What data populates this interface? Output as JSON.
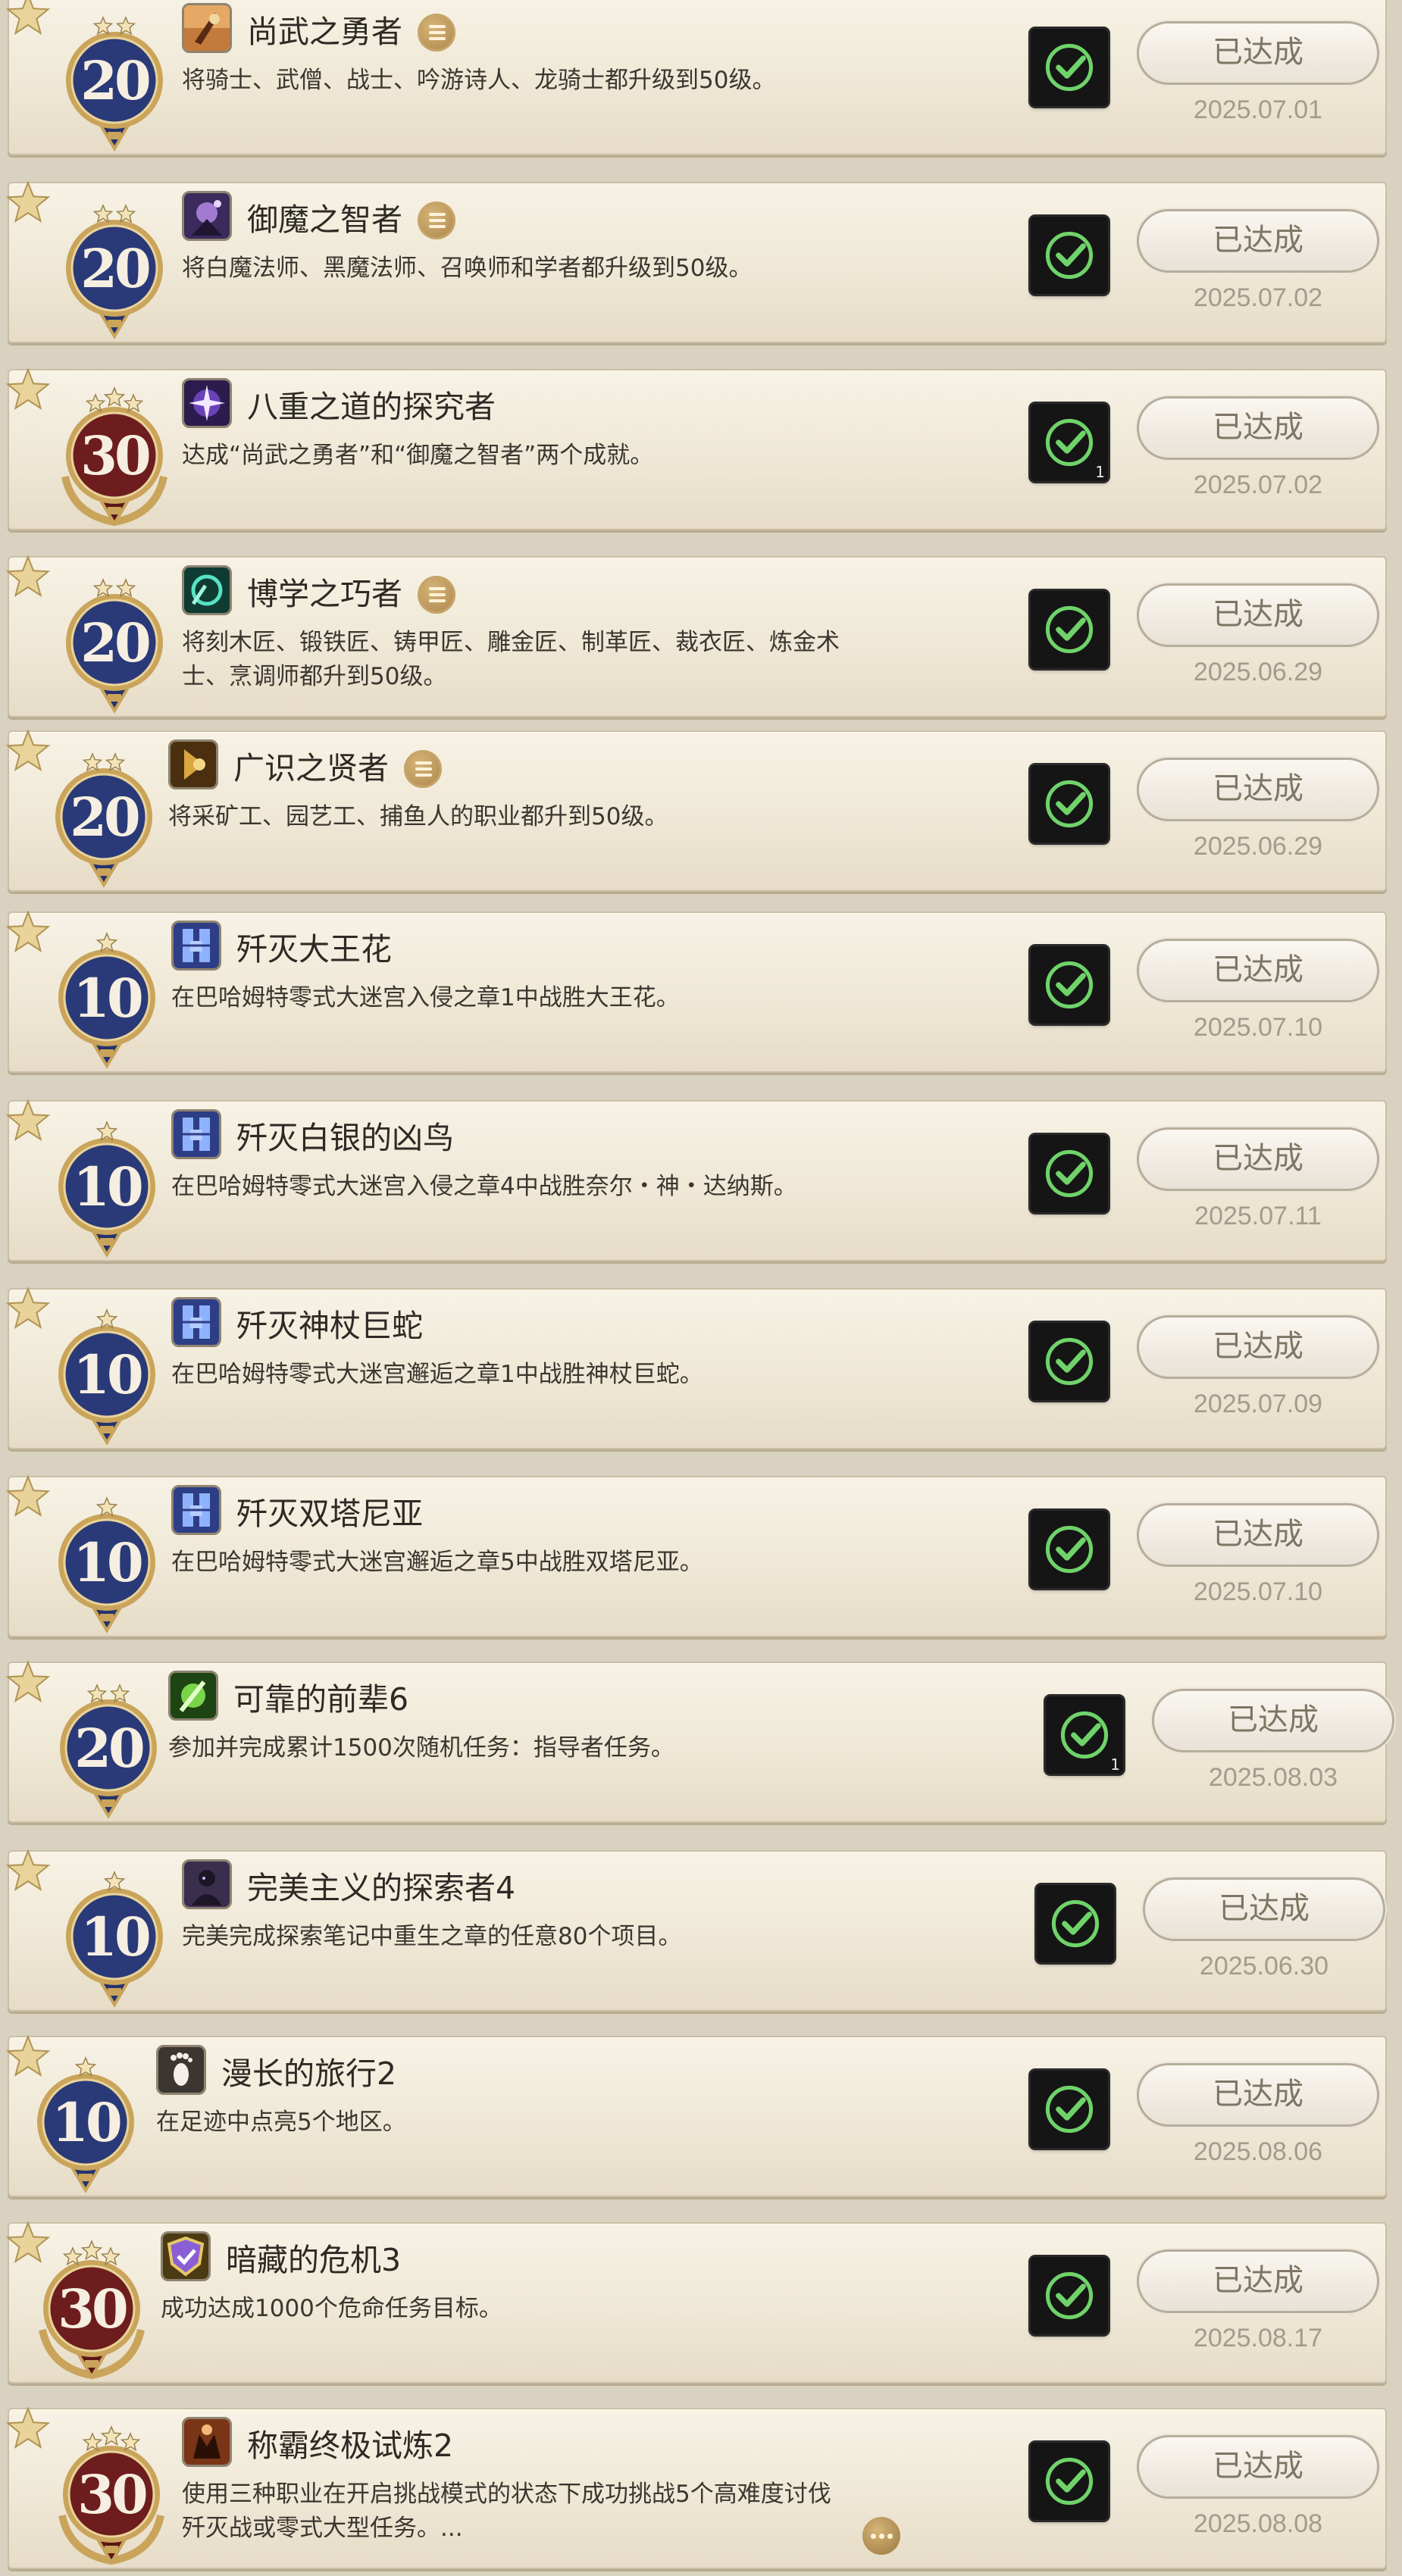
{
  "achievements": [
    {
      "points": "20",
      "tier": "blue",
      "title": "尚武之勇者",
      "has_list": true,
      "desc": "将骑士、武僧、战士、吟游诗人、龙骑士都升级到50级。",
      "status": "已达成",
      "date": "2025.07.01",
      "icon": "warrior-crest-icon",
      "check_count": ""
    },
    {
      "points": "20",
      "tier": "blue",
      "title": "御魔之智者",
      "has_list": true,
      "desc": "将白魔法师、黑魔法师、召唤师和学者都升级到50级。",
      "status": "已达成",
      "date": "2025.07.02",
      "icon": "mage-crest-icon",
      "check_count": ""
    },
    {
      "points": "30",
      "tier": "red",
      "title": "八重之道的探究者",
      "has_list": false,
      "desc": "达成“尚武之勇者”和“御魔之智者”两个成就。",
      "status": "已达成",
      "date": "2025.07.02",
      "icon": "purple-star-icon",
      "check_count": "1"
    },
    {
      "points": "20",
      "tier": "blue",
      "title": "博学之巧者",
      "has_list": true,
      "desc": "将刻木匠、锻铁匠、铸甲匠、雕金匠、制革匠、裁衣匠、炼金术士、烹调师都升到50级。",
      "status": "已达成",
      "date": "2025.06.29",
      "icon": "crafter-crest-icon",
      "check_count": ""
    },
    {
      "points": "20",
      "tier": "blue",
      "title": "广识之贤者",
      "has_list": true,
      "desc": "将采矿工、园艺工、捕鱼人的职业都升到50级。",
      "status": "已达成",
      "date": "2025.06.29",
      "icon": "gatherer-crest-icon",
      "check_count": ""
    },
    {
      "points": "10",
      "tier": "blue",
      "title": "歼灭大王花",
      "has_list": false,
      "desc": "在巴哈姆特零式大迷宫入侵之章1中战胜大王花。",
      "status": "已达成",
      "date": "2025.07.10",
      "icon": "raid-crystal-icon",
      "check_count": ""
    },
    {
      "points": "10",
      "tier": "blue",
      "title": "歼灭白银的凶鸟",
      "has_list": false,
      "desc": "在巴哈姆特零式大迷宫入侵之章4中战胜奈尔・神・达纳斯。",
      "status": "已达成",
      "date": "2025.07.11",
      "icon": "raid-crystal-icon",
      "check_count": ""
    },
    {
      "points": "10",
      "tier": "blue",
      "title": "歼灭神杖巨蛇",
      "has_list": false,
      "desc": "在巴哈姆特零式大迷宫邂逅之章1中战胜神杖巨蛇。",
      "status": "已达成",
      "date": "2025.07.09",
      "icon": "raid-crystal-icon",
      "check_count": ""
    },
    {
      "points": "10",
      "tier": "blue",
      "title": "歼灭双塔尼亚",
      "has_list": false,
      "desc": "在巴哈姆特零式大迷宫邂逅之章5中战胜双塔尼亚。",
      "status": "已达成",
      "date": "2025.07.10",
      "icon": "raid-crystal-icon",
      "check_count": ""
    },
    {
      "points": "20",
      "tier": "blue",
      "title": "可靠的前辈6",
      "has_list": false,
      "desc": "参加并完成累计1500次随机任务：指导者任务。",
      "status": "已达成",
      "date": "2025.08.03",
      "icon": "mentor-green-icon",
      "check_count": "1"
    },
    {
      "points": "10",
      "tier": "blue",
      "title": "完美主义的探索者4",
      "has_list": false,
      "desc": "完美完成探索笔记中重生之章的任意80个项目。",
      "status": "已达成",
      "date": "2025.06.30",
      "icon": "explorer-portrait-icon",
      "check_count": ""
    },
    {
      "points": "10",
      "tier": "blue",
      "title": "漫长的旅行2",
      "has_list": false,
      "desc": "在足迹中点亮5个地区。",
      "status": "已达成",
      "date": "2025.08.06",
      "icon": "footprint-icon",
      "check_count": ""
    },
    {
      "points": "30",
      "tier": "red",
      "title": "暗藏的危机3",
      "has_list": false,
      "desc": "成功达成1000个危命任务目标。",
      "status": "已达成",
      "date": "2025.08.17",
      "icon": "fate-shield-icon",
      "check_count": ""
    },
    {
      "points": "30",
      "tier": "red",
      "title": "称霸终极试炼2",
      "has_list": false,
      "desc": "使用三种职业在开启挑战模式的状态下成功挑战5个高难度讨伐歼灭战或零式大型任务。...",
      "status": "已达成",
      "date": "2025.08.08",
      "icon": "ultimate-trial-icon",
      "check_count": ""
    }
  ],
  "colors": {
    "medal_blue": "#2a3a78",
    "medal_red": "#6e1d1f",
    "medal_gold": "#c9a45a",
    "check_green": "#6fd36a",
    "card_bg": "#f2ecdd"
  }
}
